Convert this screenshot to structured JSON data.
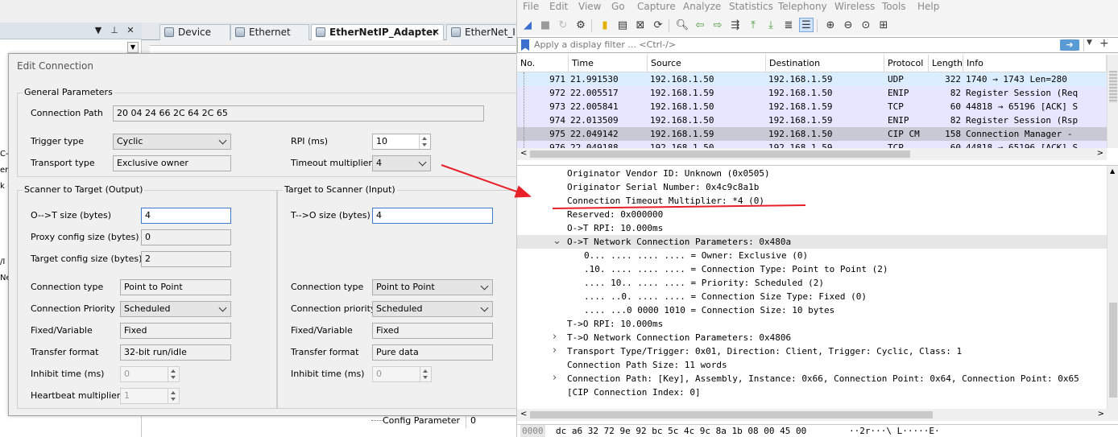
{
  "ide": {
    "tabs": [
      {
        "label": "Device"
      },
      {
        "label": "Ethernet"
      },
      {
        "label": "EtherNetIP_Adapter",
        "close": "✕"
      },
      {
        "label": "EtherNet_I"
      }
    ],
    "side_fragments": [
      "C-",
      "er",
      "k (",
      "/I",
      "Ne"
    ],
    "bottom": {
      "label": "Config Parameter",
      "value": "0"
    }
  },
  "dialog": {
    "title": "Edit Connection",
    "general": {
      "group_label": "General Parameters",
      "connection_path_label": "Connection Path",
      "connection_path": "20 04 24 66 2C 64 2C 65",
      "trigger_type_label": "Trigger type",
      "trigger_type": "Cyclic",
      "transport_type_label": "Transport type",
      "transport_type": "Exclusive owner",
      "rpi_label": "RPI (ms)",
      "rpi": "10",
      "timeout_multiplier_label": "Timeout multiplier",
      "timeout_multiplier": "4"
    },
    "o2t": {
      "group_label": "Scanner to Target (Output)",
      "size_label": "O-->T size (bytes)",
      "size": "4",
      "proxy_label": "Proxy config size (bytes)",
      "proxy": "0",
      "target_cfg_label": "Target config size (bytes)",
      "target_cfg": "2",
      "conn_type_label": "Connection type",
      "conn_type": "Point to Point",
      "priority_label": "Connection Priority",
      "priority": "Scheduled",
      "fixed_label": "Fixed/Variable",
      "fixed": "Fixed",
      "transfer_label": "Transfer format",
      "transfer": "32-bit run/idle",
      "inhibit_label": "Inhibit time (ms)",
      "inhibit": "0",
      "heartbeat_label": "Heartbeat multiplier",
      "heartbeat": "1"
    },
    "t2o": {
      "group_label": "Target to Scanner (Input)",
      "size_label": "T-->O size (bytes)",
      "size": "4",
      "conn_type_label": "Connection type",
      "conn_type": "Point to Point",
      "priority_label": "Connection priority",
      "priority": "Scheduled",
      "fixed_label": "Fixed/Variable",
      "fixed": "Fixed",
      "transfer_label": "Transfer format",
      "transfer": "Pure data",
      "inhibit_label": "Inhibit time (ms)",
      "inhibit": "0"
    }
  },
  "wireshark": {
    "menu": [
      "File",
      "Edit",
      "View",
      "Go",
      "Capture",
      "Analyze",
      "Statistics",
      "Telephony",
      "Wireless",
      "Tools",
      "Help"
    ],
    "filter_placeholder": "Apply a display filter ... <Ctrl-/>",
    "columns": [
      "No.",
      "Time",
      "Source",
      "Destination",
      "Protocol",
      "Length",
      "Info"
    ],
    "packets": [
      {
        "no": "971",
        "time": "21.991530",
        "src": "192.168.1.50",
        "dst": "192.168.1.59",
        "proto": "UDP",
        "len": "322",
        "info": "1740 → 1743 Len=280",
        "bg": "#daeeff"
      },
      {
        "no": "972",
        "time": "22.005517",
        "src": "192.168.1.59",
        "dst": "192.168.1.50",
        "proto": "ENIP",
        "len": "82",
        "info": "Register Session (Req",
        "bg": "#e7e6ff"
      },
      {
        "no": "973",
        "time": "22.005841",
        "src": "192.168.1.50",
        "dst": "192.168.1.59",
        "proto": "TCP",
        "len": "60",
        "info": "44818 → 65196 [ACK] S",
        "bg": "#e7e6ff"
      },
      {
        "no": "974",
        "time": "22.013509",
        "src": "192.168.1.50",
        "dst": "192.168.1.59",
        "proto": "ENIP",
        "len": "82",
        "info": "Register Session (Rsp",
        "bg": "#e7e6ff"
      },
      {
        "no": "975",
        "time": "22.049142",
        "src": "192.168.1.59",
        "dst": "192.168.1.50",
        "proto": "CIP CM",
        "len": "158",
        "info": "Connection Manager -",
        "bg": "#c9c9d6"
      },
      {
        "no": "976",
        "time": "22.049188",
        "src": "192.168.1.50",
        "dst": "192.168.1.59",
        "proto": "TCP",
        "len": "60",
        "info": "44818 → 65196 [ACK] S",
        "bg": "#e7e6ff"
      }
    ],
    "details": [
      {
        "text": "Originator Vendor ID: Unknown (0x0505)",
        "indent": 0,
        "tw": ""
      },
      {
        "text": "Originator Serial Number: 0x4c9c8a1b",
        "indent": 0,
        "tw": ""
      },
      {
        "text": "Connection Timeout Multiplier: *4 (0)",
        "indent": 0,
        "tw": ""
      },
      {
        "text": "Reserved: 0x000000",
        "indent": 0,
        "tw": ""
      },
      {
        "text": "O->T RPI: 10.000ms",
        "indent": 0,
        "tw": ""
      },
      {
        "text": "O->T Network Connection Parameters: 0x480a",
        "indent": 0,
        "tw": "v",
        "highlight": true
      },
      {
        "text": "0... .... .... .... = Owner: Exclusive (0)",
        "indent": 1,
        "tw": ""
      },
      {
        "text": ".10. .... .... .... = Connection Type: Point to Point (2)",
        "indent": 1,
        "tw": ""
      },
      {
        "text": ".... 10.. .... .... = Priority: Scheduled (2)",
        "indent": 1,
        "tw": ""
      },
      {
        "text": ".... ..0. .... .... = Connection Size Type: Fixed (0)",
        "indent": 1,
        "tw": ""
      },
      {
        "text": ".... ...0 0000 1010 = Connection Size: 10 bytes",
        "indent": 1,
        "tw": ""
      },
      {
        "text": "T->O RPI: 10.000ms",
        "indent": 0,
        "tw": ""
      },
      {
        "text": "T->O Network Connection Parameters: 0x4806",
        "indent": 0,
        "tw": ">"
      },
      {
        "text": "Transport Type/Trigger: 0x01, Direction: Client, Trigger: Cyclic, Class: 1",
        "indent": 0,
        "tw": ">"
      },
      {
        "text": "Connection Path Size: 11 words",
        "indent": 0,
        "tw": ""
      },
      {
        "text": "Connection Path: [Key], Assembly, Instance: 0x66, Connection Point: 0x64, Connection Point: 0x65",
        "indent": 0,
        "tw": ">"
      },
      {
        "text": "[CIP Connection Index: 0]",
        "indent": 0,
        "tw": ""
      }
    ],
    "hex": {
      "offset": "0000",
      "bytes": "dc a6 32 72 9e 92 bc 5c  4c 9c 8a 1b 08 00 45 00",
      "ascii": "··2r···\\ L·····E·"
    }
  },
  "colors": {
    "annotation_red": "#e8202a",
    "selection_blue": "#3d7bd1"
  }
}
